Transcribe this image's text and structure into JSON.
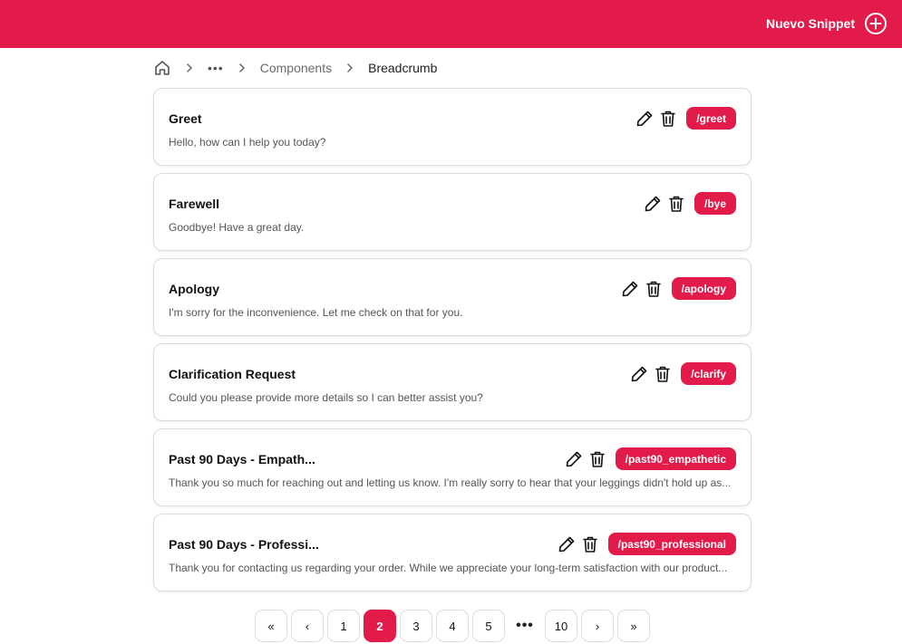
{
  "header": {
    "new_snippet_label": "Nuevo Snippet",
    "accent_color": "#e31b4a"
  },
  "breadcrumb": {
    "home_icon": "home-icon",
    "ellipsis": "•••",
    "items": [
      "Components",
      "Breadcrumb"
    ]
  },
  "snippets": [
    {
      "title": "Greet",
      "text": "Hello, how can I help you today?",
      "tag": "/greet"
    },
    {
      "title": "Farewell",
      "text": "Goodbye! Have a great day.",
      "tag": "/bye"
    },
    {
      "title": "Apology",
      "text": "I'm sorry for the inconvenience. Let me check on that for you.",
      "tag": "/apology"
    },
    {
      "title": "Clarification Request",
      "text": "Could you please provide more details so I can better assist you?",
      "tag": "/clarify"
    },
    {
      "title": "Past 90 Days - Empath...",
      "text": "Thank you so much for reaching out and letting us know. I'm really sorry to hear that your leggings didn't hold up as...",
      "tag": "/past90_empathetic"
    },
    {
      "title": "Past 90 Days - Professi...",
      "text": "Thank you for contacting us regarding your order. While we appreciate your long-term satisfaction with our product...",
      "tag": "/past90_professional"
    }
  ],
  "pagination": {
    "first": "«",
    "prev": "‹",
    "pages": [
      "1",
      "2",
      "3",
      "4",
      "5"
    ],
    "current": "2",
    "dots": "•••",
    "last_page": "10",
    "next": "›",
    "last": "»"
  }
}
